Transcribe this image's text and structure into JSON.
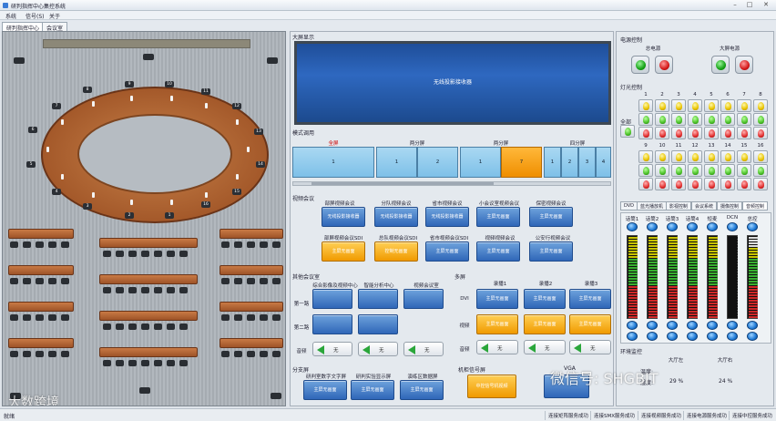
{
  "window": {
    "title": "研判指挥中心集控系统"
  },
  "menu": [
    "系统",
    "信号(S)",
    "关于"
  ],
  "tabs": [
    "研判指挥中心",
    "会议室"
  ],
  "left_panel": {
    "seat_numbers": [
      "8",
      "9",
      "10",
      "11",
      "7",
      "12",
      "6",
      "13",
      "5",
      "14",
      "4",
      "15",
      "3",
      "16",
      "2",
      "1"
    ]
  },
  "middle": {
    "big_screen_section": "大屏显示",
    "big_screen_text": "无线投影接收器",
    "mode_section": "模式调用",
    "modes": [
      {
        "header": "全屏",
        "active": true,
        "cells": [
          "1"
        ]
      },
      {
        "header": "两分屏",
        "active": false,
        "cells": [
          "1",
          "2"
        ]
      },
      {
        "header": "两分屏",
        "active": false,
        "cells": [
          "1",
          "7"
        ]
      },
      {
        "header": "四分屏",
        "active": false,
        "cells": [
          "1",
          "2",
          "3",
          "4"
        ]
      }
    ],
    "video_conf_section": "视频会议",
    "video_conf_top_labels": [
      "部屏视频会议",
      "分队视频会议",
      "省市视频会议",
      "小会议室视频会议",
      "保密视频会议"
    ],
    "video_conf_top_buttons": [
      "无线投影接收器",
      "无线投影接收器",
      "无线投影接收器",
      "主屏无画面",
      "主屏无画面"
    ],
    "video_conf_bottom_labels": [
      "部屏视频会议SDI",
      "总队视频会议SDI",
      "省市视频会议SDI",
      "视频视频会议",
      "公安行视频会议"
    ],
    "video_conf_bottom_buttons": [
      "主屏无画面",
      "控制无画面",
      "主屏无画面",
      "主屏无画面",
      "主屏无画面"
    ],
    "other_meeting_section": "其他会议室",
    "other_meeting_cols": [
      "综合影像及视频中心",
      "智能分析中心",
      "视频会议室"
    ],
    "row_labels": [
      "第一路",
      "第二路",
      "音频"
    ],
    "audio_label": "无",
    "matrix_section": "多屏",
    "matrix_cols": [
      "录播1",
      "录播2",
      "录播3"
    ],
    "matrix_rows": [
      "DVI",
      "视频",
      "音频"
    ],
    "matrix_btn": "主屏无画面",
    "extension_section": "分支屏",
    "extension_labels": [
      "研判室数字文字屏",
      "研判实验显示屏",
      "演练区数据屏"
    ],
    "extension_btn": "主屏无画面",
    "station_section": "机柜信号屏",
    "station_btn": "中控信号机视频",
    "vga_label": "VGA"
  },
  "right": {
    "power_section": "电源控制",
    "power_total": "总电源",
    "power_screen": "大屏电源",
    "light_section": "灯光控制",
    "light_all": "全部",
    "light_cols_top": [
      "1",
      "2",
      "3",
      "4",
      "5",
      "6",
      "7",
      "8"
    ],
    "light_cols_bottom": [
      "9",
      "10",
      "11",
      "12",
      "13",
      "14",
      "15",
      "16"
    ],
    "tabs": [
      "DVD",
      "蓝光播放机",
      "影视控制",
      "会议系统",
      "摄像控制",
      "音频控制"
    ],
    "meter_labels": [
      "话筒1",
      "话筒2",
      "话筒3",
      "话筒4",
      "短麦",
      "DCN",
      "总控"
    ],
    "env_section": "环境监控",
    "env_col1": "大厅左",
    "env_col2": "大厅右",
    "temp_label": "温度:",
    "humidity_label": "湿度:",
    "humidity_left": "29 %",
    "humidity_right": "24 %"
  },
  "status_bar": {
    "left": "就绪",
    "items": [
      "连接矩阵服务成功",
      "连接SMX服务成功",
      "连接视频服务成功",
      "连接电源服务成功",
      "连接中控服务成功"
    ]
  },
  "watermarks": {
    "left": "大数跨境",
    "right": "微信号: SHGBIT"
  }
}
